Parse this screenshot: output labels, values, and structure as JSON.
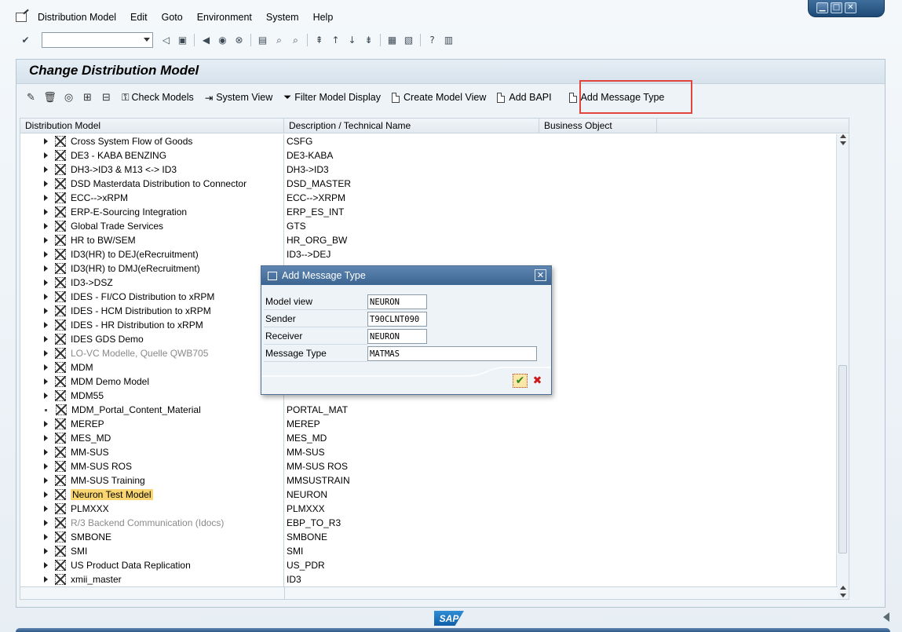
{
  "window": {
    "controls": [
      "minimize",
      "maximize",
      "close"
    ]
  },
  "menubar": {
    "items": [
      "Distribution Model",
      "Edit",
      "Goto",
      "Environment",
      "System",
      "Help"
    ]
  },
  "page_title": "Change Distribution Model",
  "app_toolbar": {
    "buttons": [
      {
        "label": "Check Models",
        "icon": "check-models-icon"
      },
      {
        "label": "System View",
        "icon": "system-view-icon"
      },
      {
        "label": "Filter Model Display",
        "icon": "filter-icon"
      },
      {
        "label": "Create Model View",
        "icon": "document-icon"
      },
      {
        "label": "Add BAPI",
        "icon": "document-icon"
      },
      {
        "label": "Add Message Type",
        "icon": "document-icon"
      }
    ]
  },
  "tree": {
    "columns": [
      "Distribution Model",
      "Description / Technical Name",
      "Business Object"
    ],
    "rows": [
      {
        "name": "Cross System Flow of Goods",
        "tech": "CSFG"
      },
      {
        "name": "DE3 - KABA BENZING",
        "tech": "DE3-KABA"
      },
      {
        "name": "DH3->ID3 & M13 <-> ID3",
        "tech": "DH3->ID3"
      },
      {
        "name": "DSD Masterdata Distribution to Connector",
        "tech": "DSD_MASTER"
      },
      {
        "name": "ECC-->xRPM",
        "tech": "ECC-->XRPM"
      },
      {
        "name": "ERP-E-Sourcing Integration",
        "tech": "ERP_ES_INT"
      },
      {
        "name": "Global Trade Services",
        "tech": "GTS"
      },
      {
        "name": "HR to BW/SEM",
        "tech": "HR_ORG_BW"
      },
      {
        "name": "ID3(HR) to DEJ(eRecruitment)",
        "tech": "ID3-->DEJ"
      },
      {
        "name": "ID3(HR) to DMJ(eRecruitment)",
        "tech": ""
      },
      {
        "name": "ID3->DSZ",
        "tech": ""
      },
      {
        "name": "IDES - FI/CO Distribution to xRPM",
        "tech": ""
      },
      {
        "name": "IDES - HCM Distribution to xRPM",
        "tech": ""
      },
      {
        "name": "IDES - HR Distribution to xRPM",
        "tech": ""
      },
      {
        "name": "IDES GDS Demo",
        "tech": ""
      },
      {
        "name": "LO-VC Modelle, Quelle QWB705",
        "tech": ""
      },
      {
        "name": "MDM",
        "tech": ""
      },
      {
        "name": "MDM Demo Model",
        "tech": ""
      },
      {
        "name": "MDM55",
        "tech": ""
      },
      {
        "name": "MDM_Portal_Content_Material",
        "tech": "PORTAL_MAT"
      },
      {
        "name": "MEREP",
        "tech": "MEREP"
      },
      {
        "name": "MES_MD",
        "tech": "MES_MD"
      },
      {
        "name": "MM-SUS",
        "tech": "MM-SUS"
      },
      {
        "name": "MM-SUS ROS",
        "tech": "MM-SUS ROS"
      },
      {
        "name": "MM-SUS Training",
        "tech": "MMSUSTRAIN"
      },
      {
        "name": "Neuron Test Model",
        "tech": "NEURON"
      },
      {
        "name": "PLMXXX",
        "tech": "PLMXXX"
      },
      {
        "name": "R/3 Backend Communication (Idocs)",
        "tech": "EBP_TO_R3"
      },
      {
        "name": "SMBONE",
        "tech": "SMBONE"
      },
      {
        "name": "SMI",
        "tech": "SMI"
      },
      {
        "name": "US Product Data Replication",
        "tech": "US_PDR"
      },
      {
        "name": "xmii_master",
        "tech": "ID3"
      }
    ]
  },
  "dialog": {
    "title": "Add Message Type",
    "fields": [
      {
        "label": "Model view",
        "value": "NEURON"
      },
      {
        "label": "Sender",
        "value": "T90CLNT090"
      },
      {
        "label": "Receiver",
        "value": "NEURON"
      },
      {
        "label": "Message Type",
        "value": "MATMAS"
      }
    ]
  },
  "footer": {
    "logo": "SAP"
  }
}
